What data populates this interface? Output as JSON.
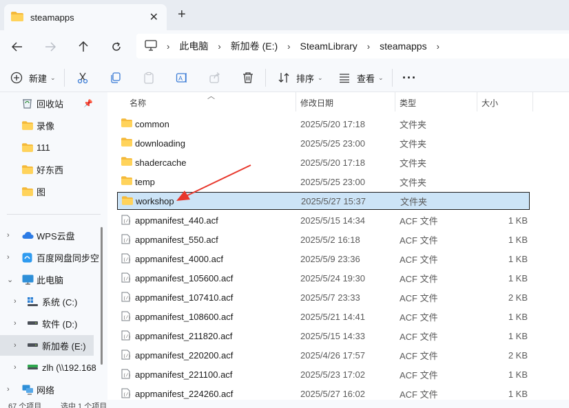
{
  "window": {
    "tab_title": "steamapps",
    "tab_icon": "folder-icon",
    "accent_color": "#ffc83d"
  },
  "address": {
    "crumbs": [
      "此电脑",
      "新加卷 (E:)",
      "SteamLibrary",
      "steamapps"
    ]
  },
  "toolbar": {
    "new_label": "新建",
    "sort_label": "排序",
    "view_label": "查看",
    "more_label": "···"
  },
  "sidebar": {
    "items": [
      {
        "label": "回收站",
        "icon": "recycle-bin-icon"
      },
      {
        "label": "录像",
        "icon": "folder-icon"
      },
      {
        "label": "111",
        "icon": "folder-icon"
      },
      {
        "label": "好东西",
        "icon": "folder-icon"
      },
      {
        "label": "图",
        "icon": "folder-icon"
      },
      {
        "label": "WPS云盘",
        "icon": "cloud-icon"
      },
      {
        "label": "百度网盘同步空",
        "icon": "baidu-netdisk-icon"
      },
      {
        "label": "此电脑",
        "icon": "monitor-icon"
      },
      {
        "label": "系统 (C:)",
        "icon": "windows-drive-icon"
      },
      {
        "label": "软件 (D:)",
        "icon": "drive-icon"
      },
      {
        "label": "新加卷 (E:)",
        "icon": "drive-icon"
      },
      {
        "label": "zlh (\\\\192.168",
        "icon": "network-drive-icon"
      },
      {
        "label": "网络",
        "icon": "network-icon"
      }
    ]
  },
  "columns": {
    "name": "名称",
    "date": "修改日期",
    "type": "类型",
    "size": "大小"
  },
  "files": [
    {
      "name": "common",
      "date": "2025/5/20 17:18",
      "type": "文件夹",
      "size": "",
      "icon": "folder-icon"
    },
    {
      "name": "downloading",
      "date": "2025/5/25 23:00",
      "type": "文件夹",
      "size": "",
      "icon": "folder-icon"
    },
    {
      "name": "shadercache",
      "date": "2025/5/20 17:18",
      "type": "文件夹",
      "size": "",
      "icon": "folder-icon"
    },
    {
      "name": "temp",
      "date": "2025/5/25 23:00",
      "type": "文件夹",
      "size": "",
      "icon": "folder-icon"
    },
    {
      "name": "workshop",
      "date": "2025/5/27 15:37",
      "type": "文件夹",
      "size": "",
      "icon": "folder-icon",
      "selected": true
    },
    {
      "name": "appmanifest_440.acf",
      "date": "2025/5/15 14:34",
      "type": "ACF 文件",
      "size": "1 KB",
      "icon": "file-icon"
    },
    {
      "name": "appmanifest_550.acf",
      "date": "2025/5/2 16:18",
      "type": "ACF 文件",
      "size": "1 KB",
      "icon": "file-icon"
    },
    {
      "name": "appmanifest_4000.acf",
      "date": "2025/5/9 23:36",
      "type": "ACF 文件",
      "size": "1 KB",
      "icon": "file-icon"
    },
    {
      "name": "appmanifest_105600.acf",
      "date": "2025/5/24 19:30",
      "type": "ACF 文件",
      "size": "1 KB",
      "icon": "file-icon"
    },
    {
      "name": "appmanifest_107410.acf",
      "date": "2025/5/7 23:33",
      "type": "ACF 文件",
      "size": "2 KB",
      "icon": "file-icon"
    },
    {
      "name": "appmanifest_108600.acf",
      "date": "2025/5/21 14:41",
      "type": "ACF 文件",
      "size": "1 KB",
      "icon": "file-icon"
    },
    {
      "name": "appmanifest_211820.acf",
      "date": "2025/5/15 14:33",
      "type": "ACF 文件",
      "size": "1 KB",
      "icon": "file-icon"
    },
    {
      "name": "appmanifest_220200.acf",
      "date": "2025/4/26 17:57",
      "type": "ACF 文件",
      "size": "2 KB",
      "icon": "file-icon"
    },
    {
      "name": "appmanifest_221100.acf",
      "date": "2025/5/23 17:02",
      "type": "ACF 文件",
      "size": "1 KB",
      "icon": "file-icon"
    },
    {
      "name": "appmanifest_224260.acf",
      "date": "2025/5/27 16:02",
      "type": "ACF 文件",
      "size": "1 KB",
      "icon": "file-icon"
    }
  ],
  "status": {
    "count": "67 个项目",
    "selection": "选中 1 个项目"
  },
  "annotation": {
    "arrow_color": "#e8372c"
  }
}
